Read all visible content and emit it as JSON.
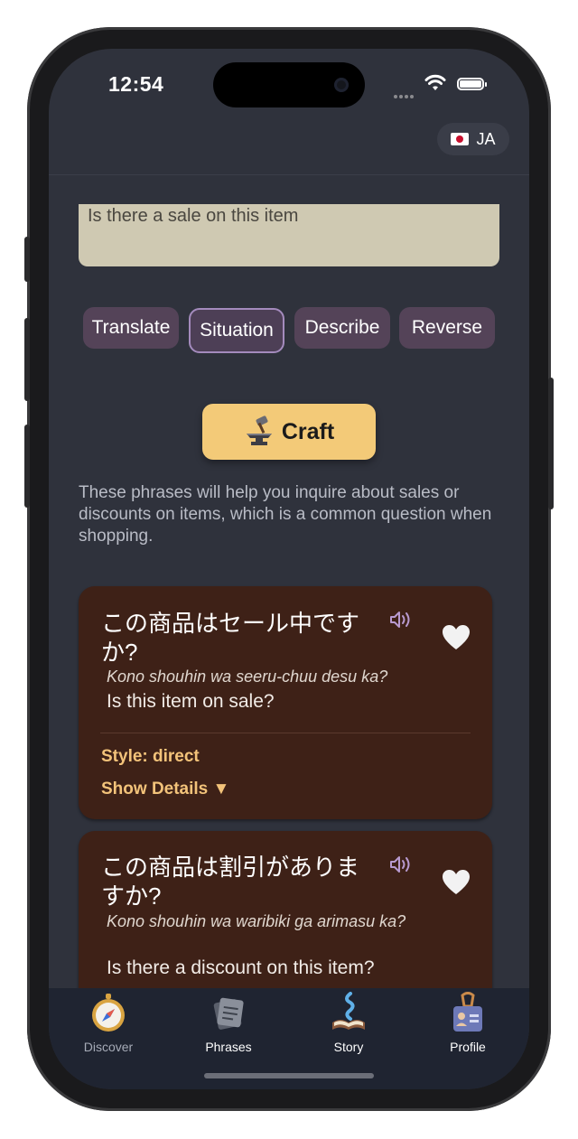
{
  "status": {
    "time": "12:54"
  },
  "header": {
    "language_code": "JA",
    "flag": "japan-flag-icon"
  },
  "input": {
    "text": "Is there a sale on this item"
  },
  "modes": [
    {
      "label": "Translate",
      "active": false
    },
    {
      "label": "Situation",
      "active": true
    },
    {
      "label": "Describe",
      "active": false
    },
    {
      "label": "Reverse",
      "active": false
    }
  ],
  "craft": {
    "label": "Craft",
    "icon": "anvil-icon"
  },
  "intro": "These phrases will help you inquire about sales or discounts on items, which is a common question when shopping.",
  "phrases": [
    {
      "japanese": "この商品はセール中ですか?",
      "romaji": "Kono shouhin wa seeru-chuu desu ka?",
      "english": "Is this item on sale?",
      "style": "Style: direct",
      "details": "Show Details ▼"
    },
    {
      "japanese": "この商品は割引がありますか?",
      "romaji": "Kono shouhin wa waribiki ga arimasu ka?",
      "english": "Is there a discount on this item?"
    }
  ],
  "tabs": [
    {
      "label": "Discover",
      "icon": "compass-icon",
      "active": true
    },
    {
      "label": "Phrases",
      "icon": "notebook-icon",
      "active": false
    },
    {
      "label": "Story",
      "icon": "story-book-icon",
      "active": false
    },
    {
      "label": "Profile",
      "icon": "id-badge-icon",
      "active": false
    }
  ],
  "colors": {
    "background": "#2f323c",
    "card": "#3e2117",
    "accent": "#f3ca78",
    "mode_button": "#544358",
    "tab_active": "#a6abb7"
  }
}
